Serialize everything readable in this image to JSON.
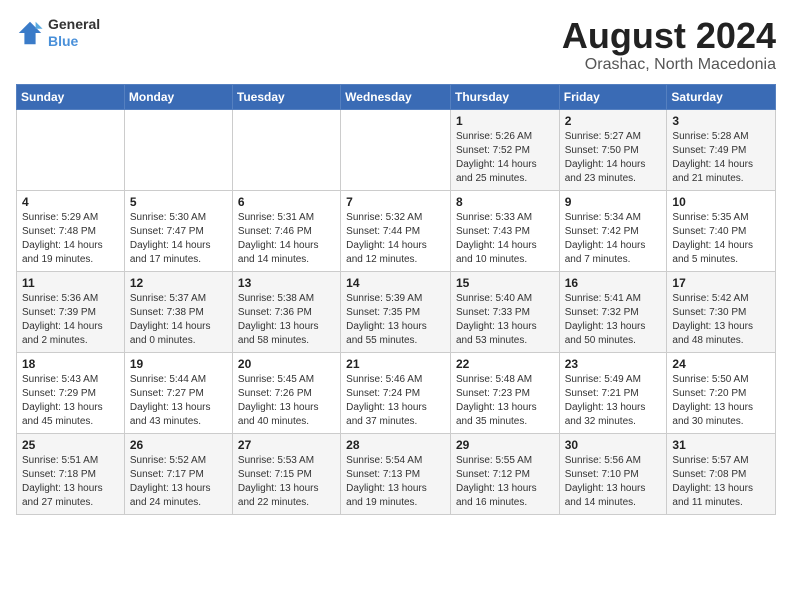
{
  "header": {
    "logo": {
      "general": "General",
      "blue": "Blue"
    },
    "month_year": "August 2024",
    "location": "Orashac, North Macedonia"
  },
  "calendar": {
    "days_of_week": [
      "Sunday",
      "Monday",
      "Tuesday",
      "Wednesday",
      "Thursday",
      "Friday",
      "Saturday"
    ],
    "weeks": [
      [
        {
          "day": "",
          "info": ""
        },
        {
          "day": "",
          "info": ""
        },
        {
          "day": "",
          "info": ""
        },
        {
          "day": "",
          "info": ""
        },
        {
          "day": "1",
          "info": "Sunrise: 5:26 AM\nSunset: 7:52 PM\nDaylight: 14 hours and 25 minutes."
        },
        {
          "day": "2",
          "info": "Sunrise: 5:27 AM\nSunset: 7:50 PM\nDaylight: 14 hours and 23 minutes."
        },
        {
          "day": "3",
          "info": "Sunrise: 5:28 AM\nSunset: 7:49 PM\nDaylight: 14 hours and 21 minutes."
        }
      ],
      [
        {
          "day": "4",
          "info": "Sunrise: 5:29 AM\nSunset: 7:48 PM\nDaylight: 14 hours and 19 minutes."
        },
        {
          "day": "5",
          "info": "Sunrise: 5:30 AM\nSunset: 7:47 PM\nDaylight: 14 hours and 17 minutes."
        },
        {
          "day": "6",
          "info": "Sunrise: 5:31 AM\nSunset: 7:46 PM\nDaylight: 14 hours and 14 minutes."
        },
        {
          "day": "7",
          "info": "Sunrise: 5:32 AM\nSunset: 7:44 PM\nDaylight: 14 hours and 12 minutes."
        },
        {
          "day": "8",
          "info": "Sunrise: 5:33 AM\nSunset: 7:43 PM\nDaylight: 14 hours and 10 minutes."
        },
        {
          "day": "9",
          "info": "Sunrise: 5:34 AM\nSunset: 7:42 PM\nDaylight: 14 hours and 7 minutes."
        },
        {
          "day": "10",
          "info": "Sunrise: 5:35 AM\nSunset: 7:40 PM\nDaylight: 14 hours and 5 minutes."
        }
      ],
      [
        {
          "day": "11",
          "info": "Sunrise: 5:36 AM\nSunset: 7:39 PM\nDaylight: 14 hours and 2 minutes."
        },
        {
          "day": "12",
          "info": "Sunrise: 5:37 AM\nSunset: 7:38 PM\nDaylight: 14 hours and 0 minutes."
        },
        {
          "day": "13",
          "info": "Sunrise: 5:38 AM\nSunset: 7:36 PM\nDaylight: 13 hours and 58 minutes."
        },
        {
          "day": "14",
          "info": "Sunrise: 5:39 AM\nSunset: 7:35 PM\nDaylight: 13 hours and 55 minutes."
        },
        {
          "day": "15",
          "info": "Sunrise: 5:40 AM\nSunset: 7:33 PM\nDaylight: 13 hours and 53 minutes."
        },
        {
          "day": "16",
          "info": "Sunrise: 5:41 AM\nSunset: 7:32 PM\nDaylight: 13 hours and 50 minutes."
        },
        {
          "day": "17",
          "info": "Sunrise: 5:42 AM\nSunset: 7:30 PM\nDaylight: 13 hours and 48 minutes."
        }
      ],
      [
        {
          "day": "18",
          "info": "Sunrise: 5:43 AM\nSunset: 7:29 PM\nDaylight: 13 hours and 45 minutes."
        },
        {
          "day": "19",
          "info": "Sunrise: 5:44 AM\nSunset: 7:27 PM\nDaylight: 13 hours and 43 minutes."
        },
        {
          "day": "20",
          "info": "Sunrise: 5:45 AM\nSunset: 7:26 PM\nDaylight: 13 hours and 40 minutes."
        },
        {
          "day": "21",
          "info": "Sunrise: 5:46 AM\nSunset: 7:24 PM\nDaylight: 13 hours and 37 minutes."
        },
        {
          "day": "22",
          "info": "Sunrise: 5:48 AM\nSunset: 7:23 PM\nDaylight: 13 hours and 35 minutes."
        },
        {
          "day": "23",
          "info": "Sunrise: 5:49 AM\nSunset: 7:21 PM\nDaylight: 13 hours and 32 minutes."
        },
        {
          "day": "24",
          "info": "Sunrise: 5:50 AM\nSunset: 7:20 PM\nDaylight: 13 hours and 30 minutes."
        }
      ],
      [
        {
          "day": "25",
          "info": "Sunrise: 5:51 AM\nSunset: 7:18 PM\nDaylight: 13 hours and 27 minutes."
        },
        {
          "day": "26",
          "info": "Sunrise: 5:52 AM\nSunset: 7:17 PM\nDaylight: 13 hours and 24 minutes."
        },
        {
          "day": "27",
          "info": "Sunrise: 5:53 AM\nSunset: 7:15 PM\nDaylight: 13 hours and 22 minutes."
        },
        {
          "day": "28",
          "info": "Sunrise: 5:54 AM\nSunset: 7:13 PM\nDaylight: 13 hours and 19 minutes."
        },
        {
          "day": "29",
          "info": "Sunrise: 5:55 AM\nSunset: 7:12 PM\nDaylight: 13 hours and 16 minutes."
        },
        {
          "day": "30",
          "info": "Sunrise: 5:56 AM\nSunset: 7:10 PM\nDaylight: 13 hours and 14 minutes."
        },
        {
          "day": "31",
          "info": "Sunrise: 5:57 AM\nSunset: 7:08 PM\nDaylight: 13 hours and 11 minutes."
        }
      ]
    ]
  }
}
